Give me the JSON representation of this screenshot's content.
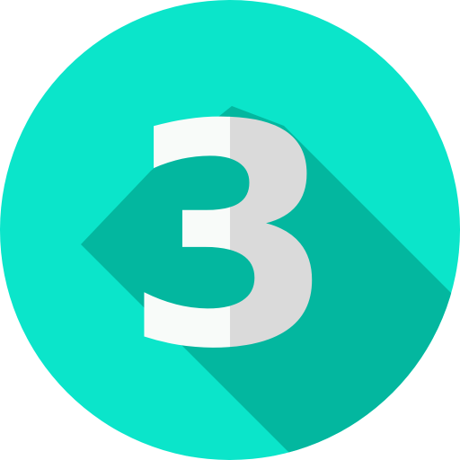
{
  "badge": {
    "numeral": "3",
    "colors": {
      "circle": "#0BE5CA",
      "shadow": "#03B79F",
      "numeral_light": "#F8FBF9",
      "numeral_shade": "#DADADA"
    }
  }
}
